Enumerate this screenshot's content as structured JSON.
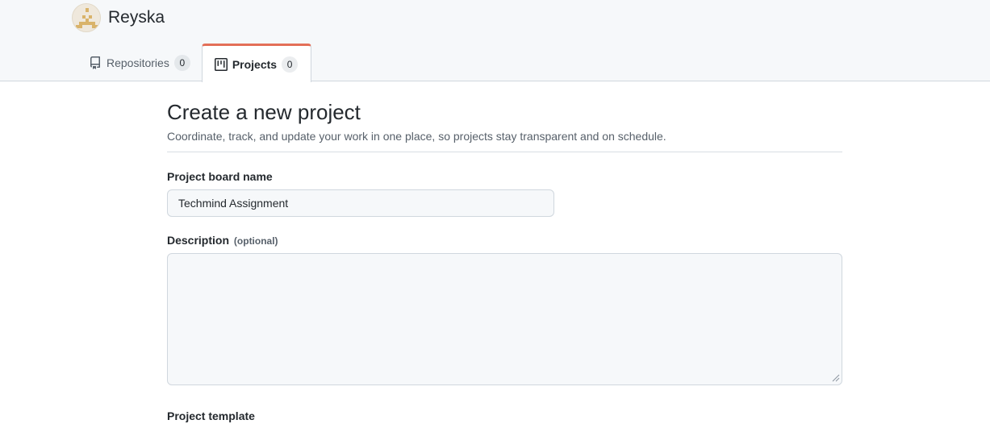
{
  "org": {
    "name": "Reyska",
    "avatar_color": "#d9b36a"
  },
  "tabs": [
    {
      "label": "Repositories",
      "count": "0",
      "icon": "repo-icon",
      "selected": false
    },
    {
      "label": "Projects",
      "count": "0",
      "icon": "project-icon",
      "selected": true
    }
  ],
  "accent_color": "#e36f58",
  "form": {
    "title": "Create a new project",
    "subtitle": "Coordinate, track, and update your work in one place, so projects stay transparent and on schedule.",
    "name_label": "Project board name",
    "name_value": "Techmind Assignment",
    "description_label": "Description",
    "description_optional": "(optional)",
    "description_value": "",
    "template_label": "Project template"
  }
}
